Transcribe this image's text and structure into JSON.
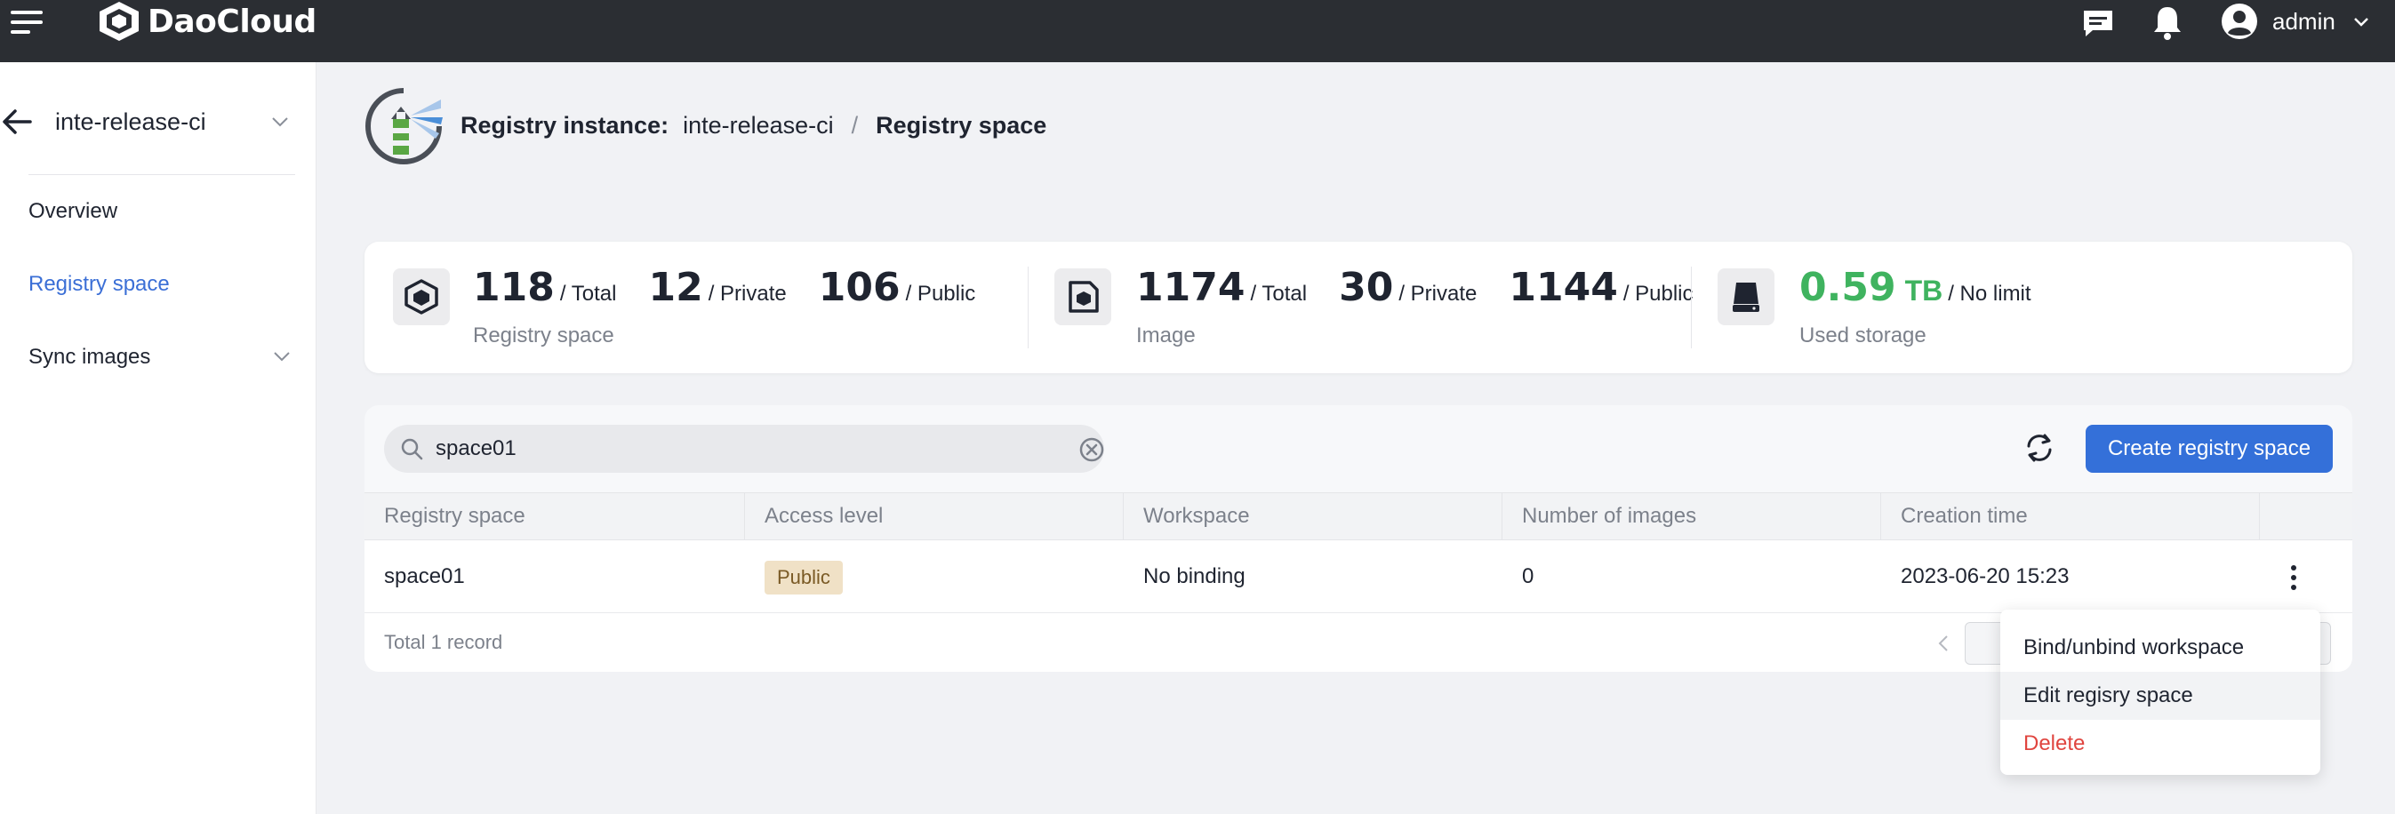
{
  "app": {
    "brand": "DaoCloud",
    "user": "admin"
  },
  "sidebar": {
    "instance": "inte-release-ci",
    "items": [
      {
        "label": "Overview"
      },
      {
        "label": "Registry space"
      },
      {
        "label": "Sync images"
      }
    ]
  },
  "breadcrumb": {
    "label": "Registry instance:",
    "instance": "inte-release-ci",
    "separator": "/",
    "current": "Registry space"
  },
  "stats": {
    "registry_space": {
      "total": "118",
      "total_unit": "/ Total",
      "private": "12",
      "private_unit": "/ Private",
      "public": "106",
      "public_unit": "/ Public",
      "caption": "Registry space"
    },
    "image": {
      "total": "1174",
      "total_unit": "/ Total",
      "private": "30",
      "private_unit": "/ Private",
      "public": "1144",
      "public_unit": "/ Public",
      "caption": "Image"
    },
    "storage": {
      "used": "0.59",
      "used_unit": "TB",
      "limit": "/ No limit",
      "caption": "Used storage"
    },
    "colors": {
      "storage_value": "#3fb35f"
    }
  },
  "toolbar": {
    "search_value": "space01",
    "create_label": "Create registry space"
  },
  "table": {
    "columns": [
      "Registry space",
      "Access level",
      "Workspace",
      "Number of images",
      "Creation time"
    ],
    "rows": [
      {
        "name": "space01",
        "access": "Public",
        "workspace": "No binding",
        "images": "0",
        "created": "2023-06-20 15:23"
      }
    ],
    "total": "Total 1 record"
  },
  "menu": {
    "items": [
      {
        "label": "Bind/unbind workspace"
      },
      {
        "label": "Edit regisry space"
      },
      {
        "label": "Delete"
      }
    ],
    "colors": {
      "danger": "#e0453f"
    }
  },
  "colors": {
    "topbar": "#2b2e33",
    "accent": "#3470d9",
    "badge_bg": "#f0e1c6"
  }
}
